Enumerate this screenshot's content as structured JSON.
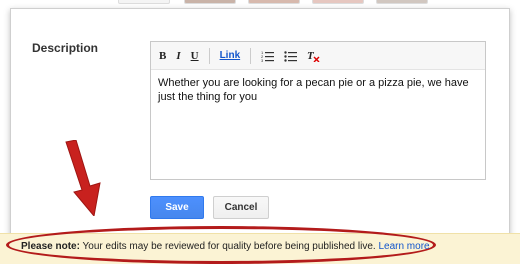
{
  "description": {
    "label": "Description",
    "text": "Whether you are looking for a pecan pie or a pizza pie, we have just the thing for you"
  },
  "toolbar": {
    "bold": "B",
    "italic": "I",
    "underline": "U",
    "link": "Link"
  },
  "buttons": {
    "save": "Save",
    "cancel": "Cancel"
  },
  "notice": {
    "strong": "Please note:",
    "message": "Your edits may be reviewed for quality before being published live.",
    "link": "Learn more"
  },
  "colors": {
    "accent": "#4d90fe",
    "link": "#1155cc",
    "highlight": "#b31b1b",
    "notice_bg": "#fbf3d4"
  }
}
